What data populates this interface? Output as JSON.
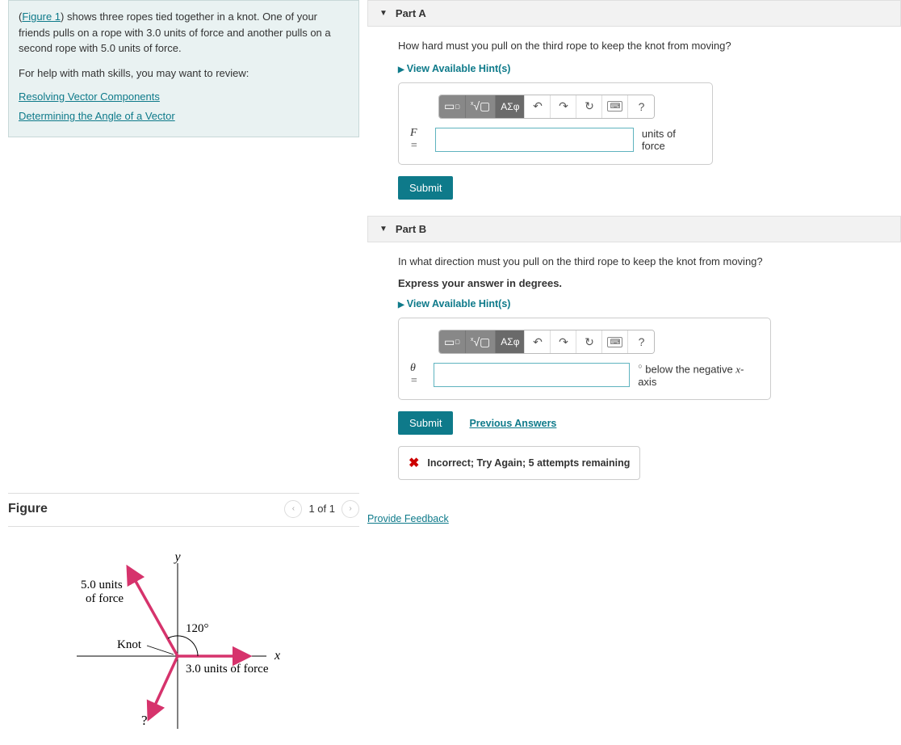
{
  "intro": {
    "figure_ref": "Figure 1",
    "text_before": "(",
    "text_after": ") shows three ropes tied together in a knot. One of your friends pulls on a rope with 3.0 units of force and another pulls on a second rope with 5.0 units of force.",
    "help_intro": "For help with math skills, you may want to review:",
    "help_links": [
      "Resolving Vector Components",
      "Determining the Angle of a Vector"
    ]
  },
  "figure": {
    "title": "Figure",
    "counter": "1 of 1",
    "labels": {
      "force_5": "5.0 units",
      "force_5b": "of force",
      "knot": "Knot",
      "angle": "120°",
      "x": "x",
      "y": "y",
      "force_3": "3.0 units of force",
      "unknown": "?"
    }
  },
  "partA": {
    "title": "Part A",
    "question": "How hard must you pull on the third rope to keep the knot from moving?",
    "hints": "View Available Hint(s)",
    "var": "F =",
    "units": "units of force",
    "submit": "Submit",
    "greek": "ΑΣφ"
  },
  "partB": {
    "title": "Part B",
    "question": "In what direction must you pull on the third rope to keep the knot from moving?",
    "express": "Express your answer in degrees.",
    "hints": "View Available Hint(s)",
    "var": "θ =",
    "units_prefix": "below the negative ",
    "units_var": "x",
    "units_suffix": "-axis",
    "submit": "Submit",
    "prev": "Previous Answers",
    "feedback": "Incorrect; Try Again; 5 attempts remaining",
    "greek": "ΑΣφ"
  },
  "footer": {
    "provide_feedback": "Provide Feedback"
  }
}
